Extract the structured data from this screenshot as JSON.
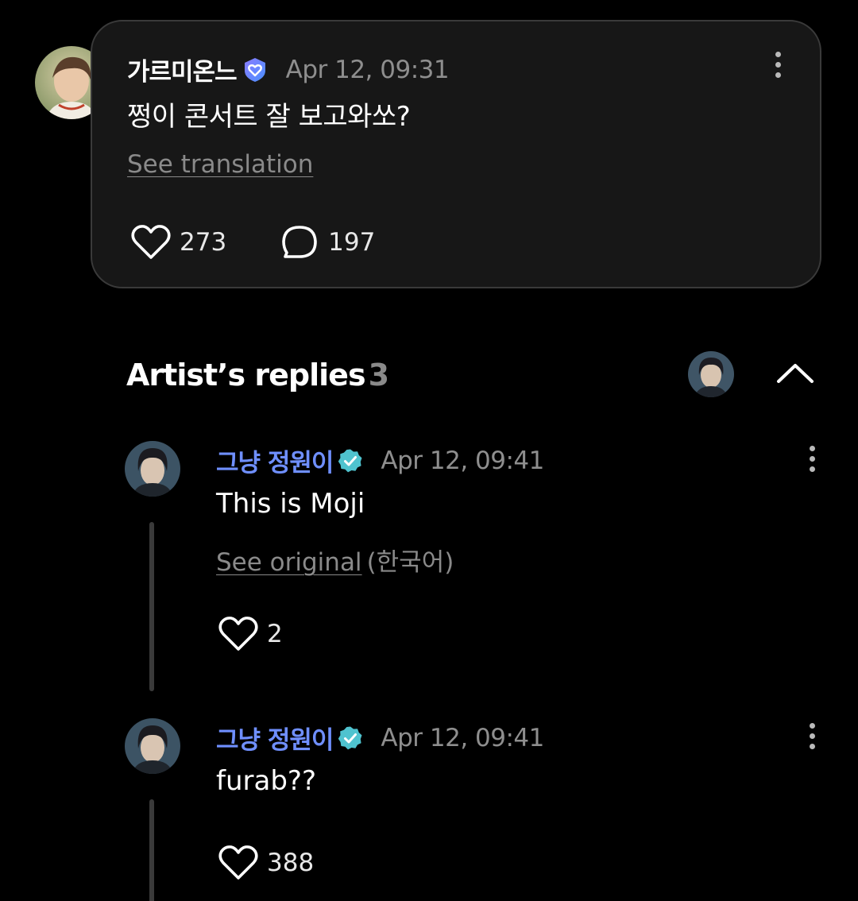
{
  "post": {
    "author": "가르미온느",
    "time": "Apr 12, 09:31",
    "text": "쩡이 콘서트 잘 보고와쏘?",
    "translate_link": "See translation",
    "likes": "273",
    "comments": "197"
  },
  "replies_section": {
    "title": "Artist’s replies",
    "count": "3"
  },
  "replies": [
    {
      "author": "그냥 정원이",
      "time": "Apr 12, 09:41",
      "text": "This is Moji",
      "original_link": "See original",
      "original_lang": "(한국어)",
      "likes": "2"
    },
    {
      "author": "그냥 정원이",
      "time": "Apr 12, 09:41",
      "text": "furab??",
      "likes": "388"
    }
  ],
  "colors": {
    "background": "#000000",
    "card": "#171717",
    "artist_name": "#6f8fff",
    "verified_badge": "#4fc3cf",
    "muted": "#8e8e8e"
  },
  "icons": {
    "fan_badge": "heart-shield-badge-icon",
    "verified": "verified-check-icon",
    "like": "heart-outline-icon",
    "comment": "comment-bubble-icon",
    "more": "more-vertical-icon",
    "collapse": "chevron-up-icon"
  }
}
